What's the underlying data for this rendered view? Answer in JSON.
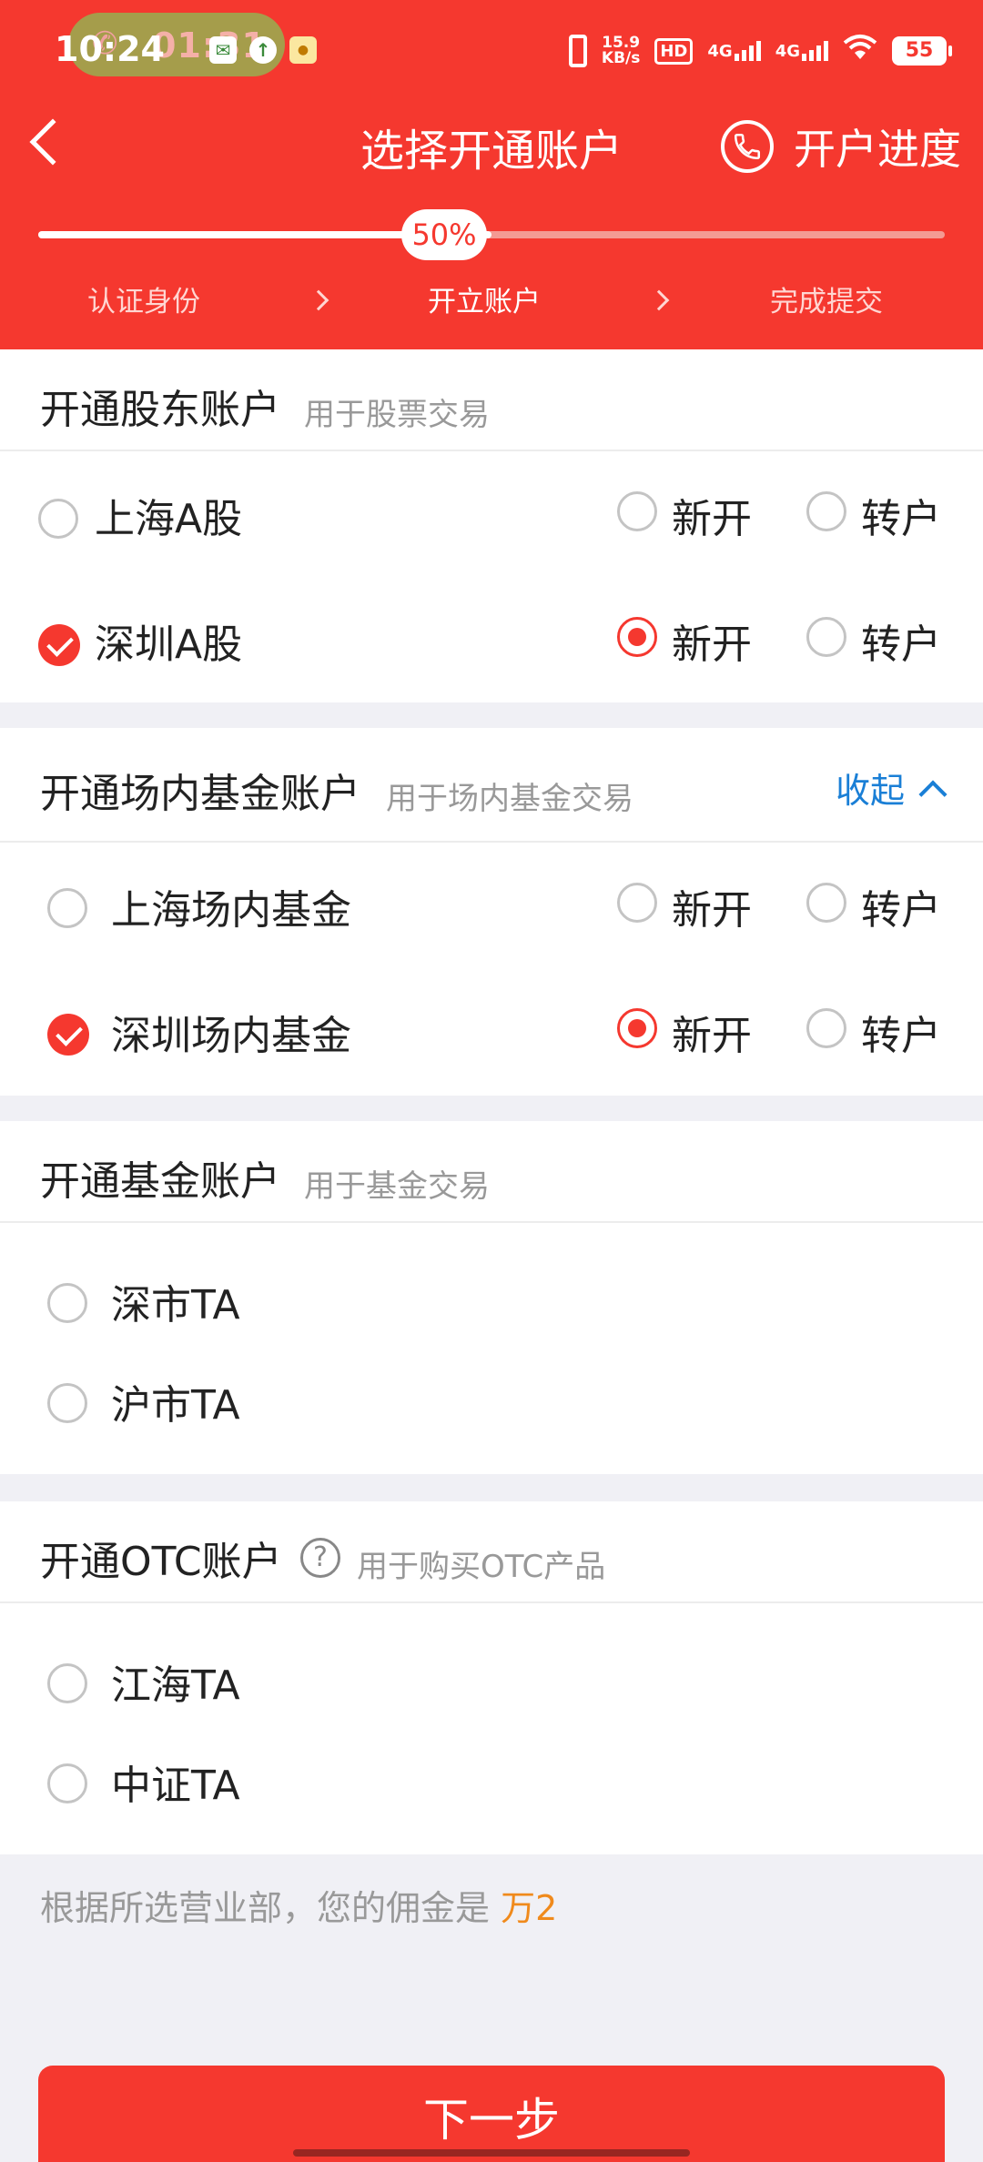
{
  "status_bar": {
    "time": "10:24",
    "call_timer": "01:31",
    "net_speed_value": "15.9",
    "net_speed_unit": "KB/s",
    "hd": "HD",
    "signal_1": "4G",
    "signal_2": "4G",
    "battery": "55"
  },
  "nav": {
    "title": "选择开通账户",
    "progress_link": "开户进度"
  },
  "progress": {
    "percent_label": "50%",
    "value": 0.5,
    "steps": [
      "认证身份",
      "开立账户",
      "完成提交"
    ],
    "active_step": 1
  },
  "sections": {
    "shareholder": {
      "title": "开通股东账户",
      "subtitle": "用于股票交易",
      "rows": [
        {
          "label": "上海A股",
          "checked": false,
          "new_label": "新开",
          "transfer_label": "转户",
          "new_selected": false
        },
        {
          "label": "深圳A股",
          "checked": true,
          "new_label": "新开",
          "transfer_label": "转户",
          "new_selected": true
        }
      ]
    },
    "exchange_fund": {
      "title": "开通场内基金账户",
      "subtitle": "用于场内基金交易",
      "collapse_label": "收起",
      "rows": [
        {
          "label": "上海场内基金",
          "checked": false,
          "new_label": "新开",
          "transfer_label": "转户",
          "new_selected": false
        },
        {
          "label": "深圳场内基金",
          "checked": true,
          "new_label": "新开",
          "transfer_label": "转户",
          "new_selected": true
        }
      ]
    },
    "fund": {
      "title": "开通基金账户",
      "subtitle": "用于基金交易",
      "rows": [
        {
          "label": "深市TA",
          "checked": false
        },
        {
          "label": "沪市TA",
          "checked": false
        }
      ]
    },
    "otc": {
      "title": "开通OTC账户",
      "help": "?",
      "subtitle": "用于购买OTC产品",
      "rows": [
        {
          "label": "江海TA",
          "checked": false
        },
        {
          "label": "中证TA",
          "checked": false
        }
      ]
    }
  },
  "commission": {
    "text": "根据所选营业部，您的佣金是",
    "value": "万2"
  },
  "next_button": "下一步",
  "colors": {
    "brand_red": "#f5382f",
    "link_blue": "#1a7fd6",
    "commission_orange": "#f08a1c"
  },
  "icons": {
    "back": "chevron-left-icon",
    "phone": "phone-icon",
    "collapse": "chevron-up-icon",
    "help": "question-circle-icon"
  }
}
